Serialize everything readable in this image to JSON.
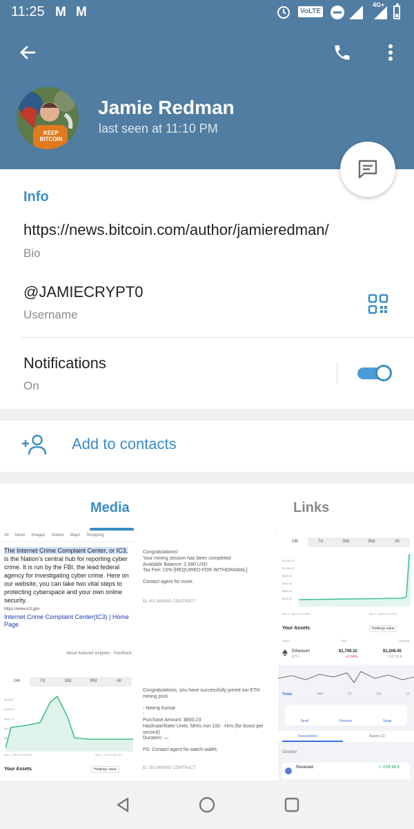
{
  "status": {
    "time": "11:25",
    "volte": "VoLTE",
    "net": "4G+"
  },
  "profile": {
    "name": "Jamie Redman",
    "last_seen": "last seen at 11:10 PM",
    "avatar_text": "KEEP BITCOIN"
  },
  "info": {
    "title": "Info",
    "bio_value": "https://news.bitcoin.com/author/jamieredman/",
    "bio_label": "Bio",
    "username_value": "@JAMIECRYPT0",
    "username_label": "Username",
    "notifications_label": "Notifications",
    "notifications_state": "On",
    "notifications_on": true
  },
  "add_contacts": "Add to contacts",
  "tabs": [
    {
      "label": "Media",
      "active": true
    },
    {
      "label": "Links",
      "active": false
    }
  ],
  "thumbs": {
    "t1": {
      "nav": [
        "All",
        "News",
        "Images",
        "Videos",
        "Maps",
        "Shopping"
      ],
      "highlight": "The Internet Crime Complaint Center, or IC3,",
      "body": "is the Nation's central hub for reporting cyber crime. It is run by the FBI, the lead federal agency for investigating cyber crime. Here on our website, you can take two vital steps to protecting cyberspace and your own online security.",
      "source": "https://www.ic3.gov",
      "link": "Internet Crime Complaint Center(IC3) | Home Page",
      "footer": "About featured snippets · Feedback"
    },
    "t2": {
      "lines": [
        "Congratulations!",
        "Your mining session has been completed",
        "Available Balance: 2,580 USD",
        "Tax Fee: 15% [REQUIRED FOR WITHDRAWAL]",
        "",
        "Contact agent for more."
      ],
      "footer": "$1 401 MINING CONTRACT"
    },
    "t3": {
      "ranges": [
        "24h",
        "7d",
        "30d",
        "90d",
        "All"
      ],
      "yticks": [
        "$1,200.00",
        "$1,000.00",
        "$800.00",
        "$600.00",
        "$400.00",
        "$200.00"
      ],
      "dates": [
        "Nov 2, 2023 12:40 PM",
        "Dec 2, 2023 12:40 PM"
      ],
      "assets_title": "Your Assets",
      "holdings": "Holdings value",
      "cols": [
        "Asset",
        "Price",
        "Holdings"
      ],
      "asset_name": "Ethereum",
      "asset_sym": "ETH",
      "price": "$1,759.32",
      "change": "+2.04%",
      "holding_value": "$1,208.45",
      "holding_amt": "0.6716 E"
    },
    "t4": {
      "ranges": [
        "24h",
        "7d",
        "30d",
        "90d",
        "All"
      ],
      "yticks": [
        "$140.67",
        "$126.59",
        "$115.74",
        "$102.59",
        "$89.43"
      ],
      "dates": [
        "Nov 1, 2023 12:30 PM",
        "Nov 1, 2023 1:55 PM"
      ],
      "assets_title": "Your Assets",
      "holdings": "Holdings value"
    },
    "t5": {
      "lines": [
        "Congratulations, you have successfully joined our ETH mining pool.",
        "",
        "- Neeraj Kumar",
        "-",
        "Purchase Amount: $800.23",
        "Hashrate/Rate/ Units: MH/s min 100 · Hr/s (for boost per second)",
        "Duration: —",
        "",
        "PS: Contact agent for watch wallet."
      ],
      "footer": "$1 301 MINING CONTRACT"
    },
    "t6": {
      "periods": [
        "Today",
        "24H",
        "7D",
        "1M",
        "1Y"
      ],
      "actions": [
        "Send",
        "Receive",
        "Swap"
      ],
      "tab_tx": "Transactions",
      "tab_assets": "Assets (1)",
      "month": "October",
      "tx_label": "Received",
      "tx_amount": "+ US$ 86.6"
    }
  },
  "colors": {
    "header": "#517da2",
    "accent": "#3a8cc6",
    "chart_green": "#3ec28a"
  }
}
